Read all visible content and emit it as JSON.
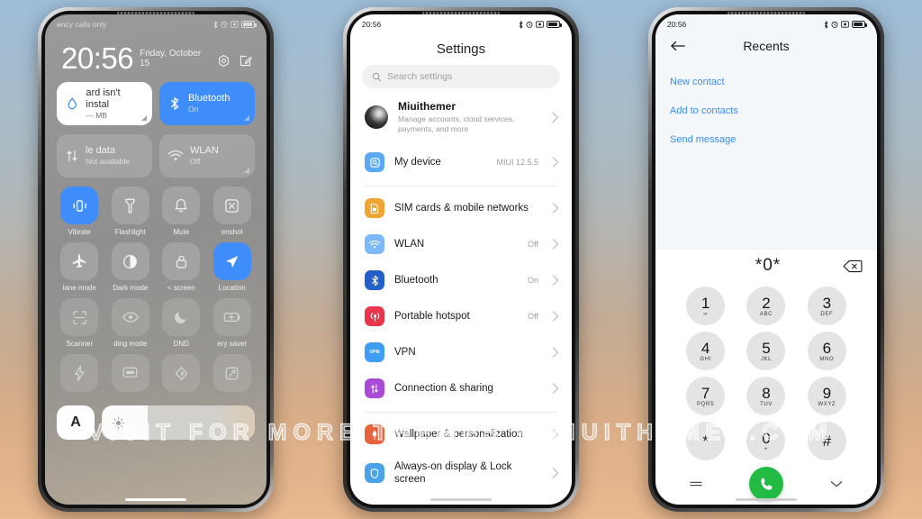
{
  "watermark": {
    "text": "VISIT FOR MORE THEMES - MIUITHEMER.COM"
  },
  "colors": {
    "accent_blue": "#3f8cfb",
    "link_blue": "#3c8dea",
    "call_green": "#22bb44",
    "settings_bg": "#ffffff"
  },
  "phone1": {
    "status": {
      "time_hidden": "",
      "carrier": "ency calls only"
    },
    "clock": {
      "time": "20:56",
      "date": "Friday, October 15"
    },
    "clock_actions": [
      {
        "name": "alarm-icon"
      },
      {
        "name": "edit-note-icon"
      }
    ],
    "big_tiles": [
      {
        "title": "ard isn't instal",
        "sub": "--- MB",
        "state": "off",
        "icon": "water-drop-icon"
      },
      {
        "title": "Bluetooth",
        "sub": "On",
        "state": "on",
        "icon": "bluetooth-icon"
      },
      {
        "title": "le data",
        "sub": "Not available",
        "state": "dim",
        "icon": "mobile-data-icon"
      },
      {
        "title": "WLAN",
        "sub": "Off",
        "state": "dim",
        "icon": "wifi-icon"
      }
    ],
    "tiles": [
      {
        "label": "Vibrate",
        "icon": "vibrate-icon",
        "state": "on"
      },
      {
        "label": "Flashlight",
        "icon": "flashlight-icon",
        "state": "off"
      },
      {
        "label": "Mute",
        "icon": "bell-icon",
        "state": "off"
      },
      {
        "label": "enshot",
        "icon": "screenshot-icon",
        "state": "off"
      },
      {
        "label": "lane mode",
        "icon": "airplane-icon",
        "state": "off"
      },
      {
        "label": "Dark mode",
        "icon": "contrast-icon",
        "state": "off"
      },
      {
        "label": "< screen",
        "icon": "lock-icon",
        "state": "off"
      },
      {
        "label": "Location",
        "icon": "location-icon",
        "state": "on"
      },
      {
        "label": "Scanner",
        "icon": "scanner-icon",
        "state": "off"
      },
      {
        "label": "ding mode",
        "icon": "eye-icon",
        "state": "off"
      },
      {
        "label": "DND",
        "icon": "moon-icon",
        "state": "off"
      },
      {
        "label": "ery saver",
        "icon": "battery-saver-icon",
        "state": "off"
      },
      {
        "label": "",
        "icon": "flash-icon",
        "state": "faint"
      },
      {
        "label": "",
        "icon": "cast-icon",
        "state": "faint"
      },
      {
        "label": "",
        "icon": "nfc-icon",
        "state": "faint"
      },
      {
        "label": "",
        "icon": "rotate-icon",
        "state": "faint"
      }
    ],
    "brightness": {
      "auto_label": "A",
      "slider_icon": "sun-icon"
    }
  },
  "phone2": {
    "status": {
      "time": "20:56"
    },
    "title": "Settings",
    "search": {
      "placeholder": "Search settings",
      "icon": "search-icon"
    },
    "account": {
      "name": "Miuithemer",
      "desc": "Manage accounts, cloud services, payments, and more"
    },
    "items": [
      {
        "label": "My device",
        "value": "MIUI 12.5.5",
        "icon": "my-device-icon",
        "color": "#5aa9f7",
        "glyph": "▣",
        "group": 0
      },
      {
        "label": "SIM cards & mobile networks",
        "value": "",
        "icon": "sim-card-icon",
        "color": "#f0a431",
        "glyph": "▤",
        "group": 1
      },
      {
        "label": "WLAN",
        "value": "Off",
        "icon": "wifi-icon",
        "color": "#7cb9f8",
        "glyph": "◠",
        "group": 1
      },
      {
        "label": "Bluetooth",
        "value": "On",
        "icon": "bluetooth-icon",
        "color": "#2360c9",
        "glyph": "ᛗ",
        "group": 1
      },
      {
        "label": "Portable hotspot",
        "value": "Off",
        "icon": "hotspot-icon",
        "color": "#e8354a",
        "glyph": "Ⓐ",
        "group": 1
      },
      {
        "label": "VPN",
        "value": "",
        "icon": "vpn-icon",
        "color": "#3f9df3",
        "glyph": "VPN",
        "group": 1
      },
      {
        "label": "Connection & sharing",
        "value": "",
        "icon": "connection-sharing-icon",
        "color": "#a94bd6",
        "glyph": "↕",
        "group": 1
      },
      {
        "label": "Wallpaper & personalization",
        "value": "",
        "icon": "wallpaper-icon",
        "color": "#e8633c",
        "glyph": "✎",
        "group": 2
      },
      {
        "label": "Always-on display & Lock screen",
        "value": "",
        "icon": "aod-lockscreen-icon",
        "color": "#4aa3e8",
        "glyph": "◯",
        "group": 2
      }
    ]
  },
  "phone3": {
    "status": {
      "time": "20:56"
    },
    "title": "Recents",
    "back_icon": "back-arrow-icon",
    "links": [
      "New contact",
      "Add to contacts",
      "Send message"
    ],
    "dialed_number": "*0*",
    "backspace_icon": "backspace-icon",
    "keys": [
      {
        "digit": "1",
        "sub": "∞"
      },
      {
        "digit": "2",
        "sub": "ABC"
      },
      {
        "digit": "3",
        "sub": "DEF"
      },
      {
        "digit": "4",
        "sub": "GHI"
      },
      {
        "digit": "5",
        "sub": "JKL"
      },
      {
        "digit": "6",
        "sub": "MNO"
      },
      {
        "digit": "7",
        "sub": "PQRS"
      },
      {
        "digit": "8",
        "sub": "TUV"
      },
      {
        "digit": "9",
        "sub": "WXYZ"
      },
      {
        "digit": "*",
        "sub": ""
      },
      {
        "digit": "0",
        "sub": "+"
      },
      {
        "digit": "#",
        "sub": ""
      }
    ],
    "bottom": {
      "left_icon": "keypad-menu-icon",
      "call_icon": "call-icon",
      "right_icon": "chevron-down-icon"
    }
  }
}
